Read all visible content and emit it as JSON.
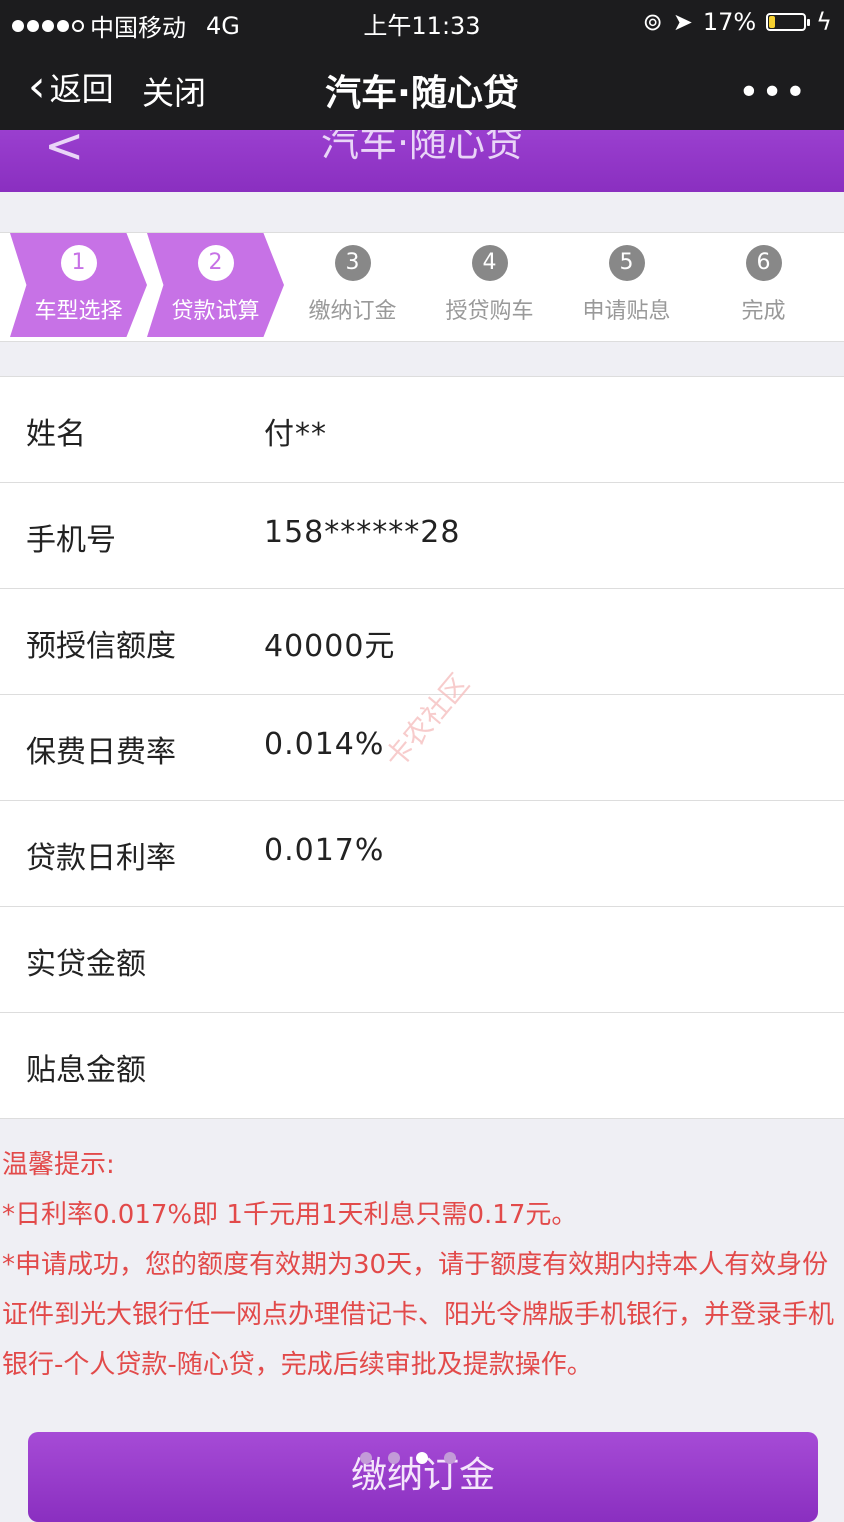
{
  "status_bar": {
    "carrier": "中国移动",
    "network": "4G",
    "time": "上午11:33",
    "battery_percent": "17%",
    "battery_level": 0.17
  },
  "nav": {
    "back_label": "返回",
    "close_label": "关闭",
    "title": "汽车·随心贷",
    "more_label": "•••"
  },
  "page_header": {
    "title": "汽车·随心贷",
    "back_glyph": "<"
  },
  "steps": [
    {
      "num": "1",
      "label": "车型选择",
      "active": true
    },
    {
      "num": "2",
      "label": "贷款试算",
      "active": true
    },
    {
      "num": "3",
      "label": "缴纳订金",
      "active": false
    },
    {
      "num": "4",
      "label": "授贷购车",
      "active": false
    },
    {
      "num": "5",
      "label": "申请贴息",
      "active": false
    },
    {
      "num": "6",
      "label": "完成",
      "active": false
    }
  ],
  "form": {
    "name_label": "姓名",
    "name_value": "付**",
    "phone_label": "手机号",
    "phone_value": "158******28",
    "credit_label": "预授信额度",
    "credit_value": "40000元",
    "insurance_rate_label": "保费日费率",
    "insurance_rate_value": "0.014%",
    "loan_rate_label": "贷款日利率",
    "loan_rate_value": "0.017%",
    "actual_amount_label": "实贷金额",
    "actual_amount_value": "",
    "subsidy_amount_label": "贴息金额",
    "subsidy_amount_value": ""
  },
  "tips": {
    "title": "温馨提示:",
    "line1": "*日利率0.017%即 1千元用1天利息只需0.17元。",
    "line2": "*申请成功，您的额度有效期为30天，请于额度有效期内持本人有效身份证件到光大银行任一网点办理借记卡、阳光令牌版手机银行，并登录手机银行-个人贷款-随心贷，完成后续审批及提款操作。"
  },
  "watermark": "卡农社区",
  "pay_button_label": "缴纳订金",
  "colors": {
    "accent": "#8a2fc0",
    "step_active": "#c772e6",
    "tips_text": "#e24a4a"
  }
}
